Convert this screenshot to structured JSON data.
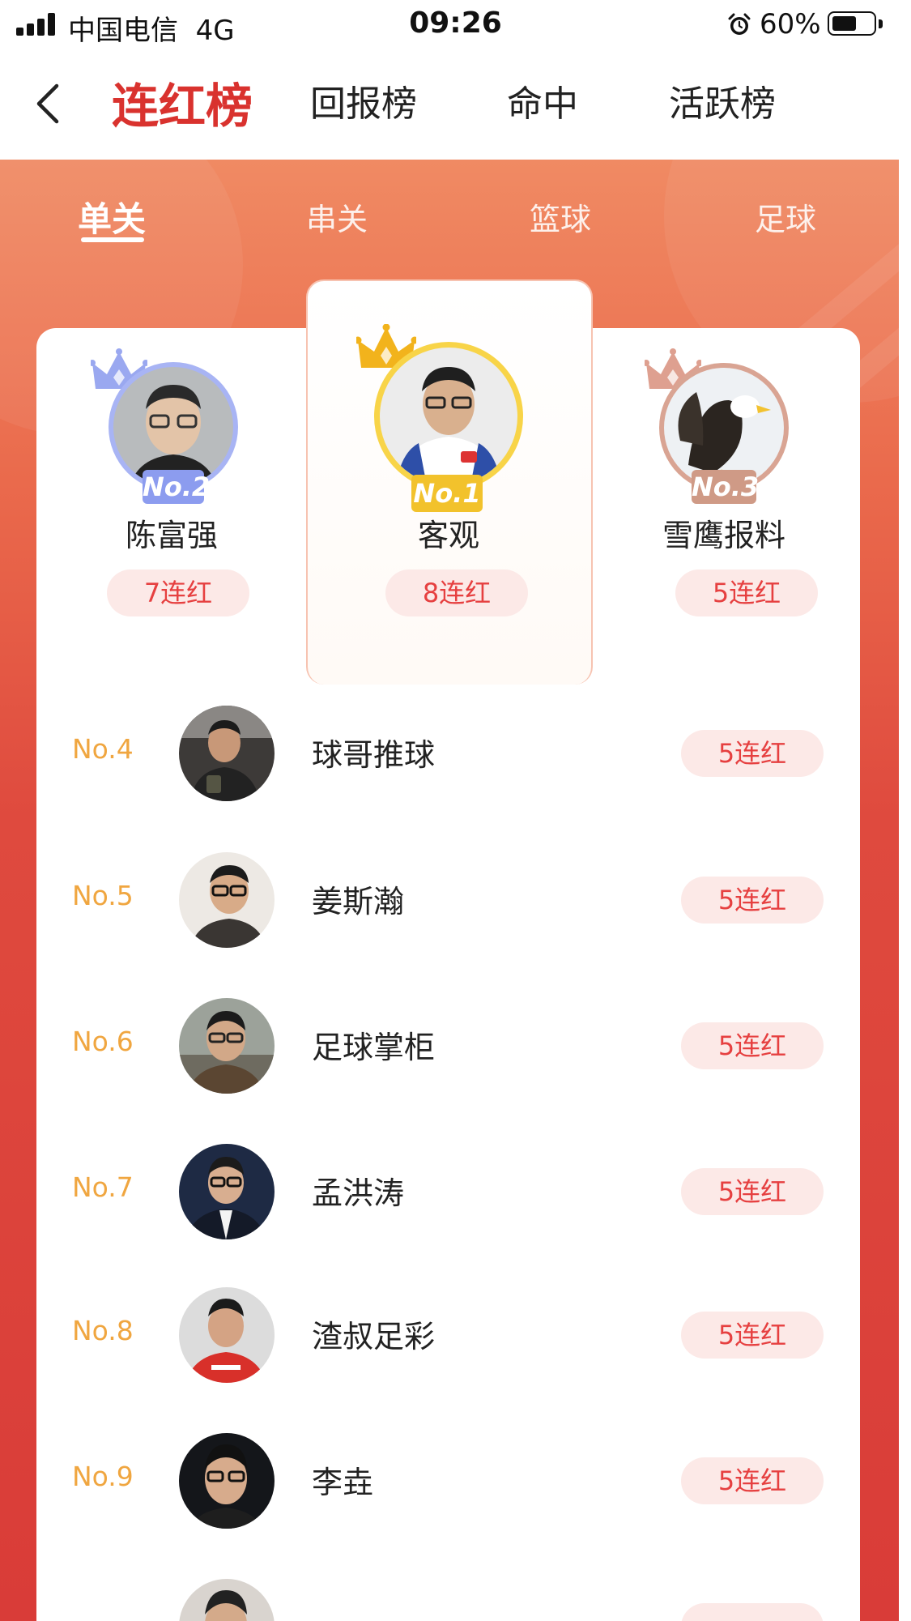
{
  "status_bar": {
    "carrier": "中国电信",
    "network": "4G",
    "time": "09:26",
    "battery": "60%",
    "battery_level": 0.6
  },
  "header": {
    "tabs": [
      {
        "label": "连红榜",
        "active": true
      },
      {
        "label": "回报榜",
        "active": false
      },
      {
        "label": "命中",
        "active": false
      },
      {
        "label": "活跃榜",
        "active": false
      }
    ]
  },
  "sub_tabs": [
    {
      "label": "单关",
      "active": true
    },
    {
      "label": "串关",
      "active": false
    },
    {
      "label": "篮球",
      "active": false
    },
    {
      "label": "足球",
      "active": false
    }
  ],
  "podium": [
    {
      "rank": "No.2",
      "name": "陈富强",
      "streak": "7连红",
      "ring_color": "#a8b4f4",
      "tag_color": "#8c9cef"
    },
    {
      "rank": "No.1",
      "name": "客观",
      "streak": "8连红",
      "ring_color": "#f8d448",
      "tag_color": "#f2c22c"
    },
    {
      "rank": "No.3",
      "name": "雪鹰报料",
      "streak": "5连红",
      "ring_color": "#d9a493",
      "tag_color": "#cf9a86"
    }
  ],
  "list": [
    {
      "rank": "No.4",
      "name": "球哥推球",
      "streak": "5连红"
    },
    {
      "rank": "No.5",
      "name": "姜斯瀚",
      "streak": "5连红"
    },
    {
      "rank": "No.6",
      "name": "足球掌柜",
      "streak": "5连红"
    },
    {
      "rank": "No.7",
      "name": "孟洪涛",
      "streak": "5连红"
    },
    {
      "rank": "No.8",
      "name": "渣叔足彩",
      "streak": "5连红"
    },
    {
      "rank": "No.9",
      "name": "李垚",
      "streak": "5连红"
    }
  ],
  "colors": {
    "accent": "#d9322e",
    "rank_gold": "#f0a640",
    "pill_bg": "#fce9e7",
    "pill_text": "#e64040"
  }
}
